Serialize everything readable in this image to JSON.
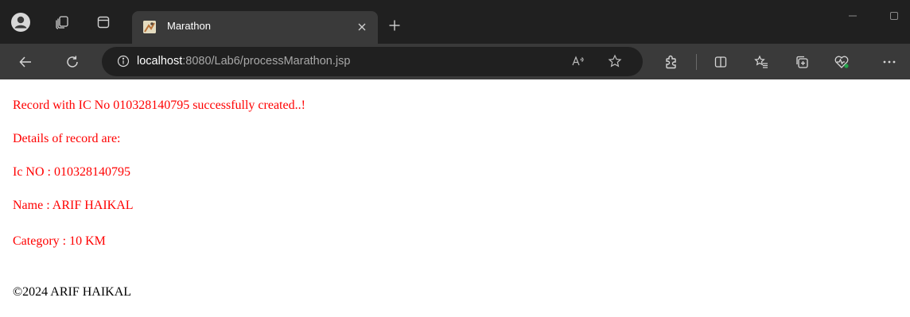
{
  "browser": {
    "tab": {
      "title": "Marathon"
    },
    "address": {
      "host": "localhost",
      "path": ":8080/Lab6/processMarathon.jsp"
    },
    "colors": {
      "titlebar": "#202020",
      "toolbar": "#3a3a3a",
      "addressbar": "#202020"
    }
  },
  "page": {
    "lines": [
      "Record with IC No 010328140795 successfully created..!",
      "Details of record are:",
      "Ic NO : 010328140795",
      "Name : ARIF HAIKAL",
      "Category : 10 KM"
    ],
    "footer": "©2024 ARIF HAIKAL",
    "colors": {
      "message": "#ff0000",
      "footer": "#000000"
    }
  }
}
